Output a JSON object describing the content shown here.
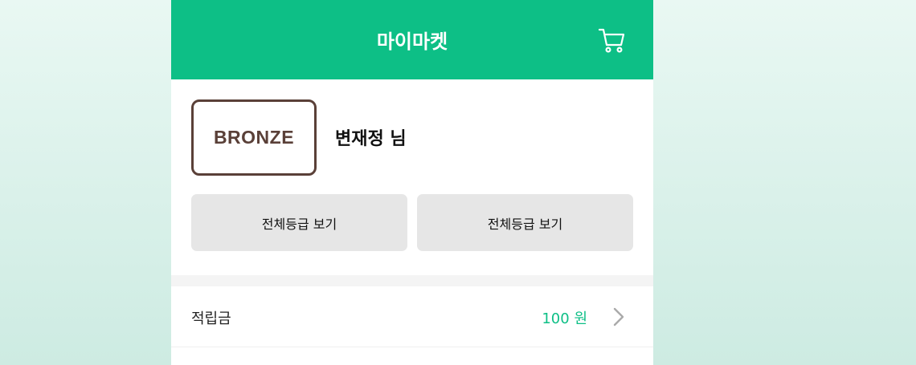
{
  "header": {
    "title": "마이마켓",
    "cart_icon": "cart-icon"
  },
  "profile": {
    "grade": "BRONZE",
    "user_name": "변재정 님",
    "grade_color": "#5a4038"
  },
  "buttons": {
    "left_label": "전체등급 보기",
    "right_label": "전체등급 보기"
  },
  "points": {
    "label": "적립금",
    "value": "100 원",
    "chevron_icon": "chevron-right-icon"
  },
  "colors": {
    "accent": "#0dbf86",
    "button_bg": "#e6e6e6"
  }
}
